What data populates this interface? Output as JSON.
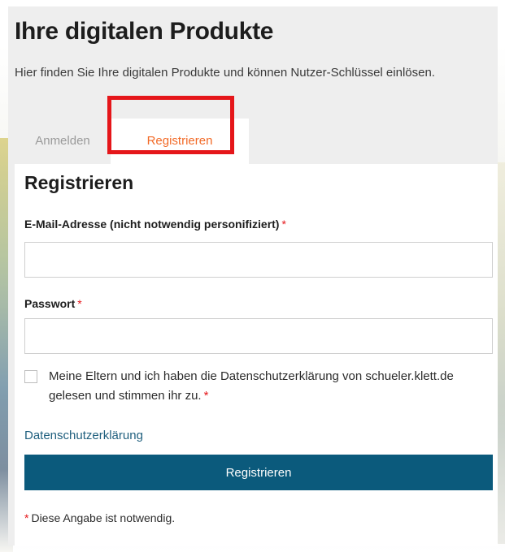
{
  "header": {
    "title": "Ihre digitalen Produkte",
    "intro": "Hier finden Sie Ihre digitalen Produkte und können Nutzer-Schlüssel einlösen."
  },
  "tabs": [
    {
      "label": "Anmelden",
      "active": false
    },
    {
      "label": "Registrieren",
      "active": true
    }
  ],
  "form": {
    "title": "Registrieren",
    "email_label": "E-Mail-Adresse (nicht notwendig personifiziert)",
    "email_value": "",
    "password_label": "Passwort",
    "password_value": "",
    "required_mark": "*",
    "consent_text": "Meine Eltern und ich haben die Datenschutzerklärung von schueler.klett.de gelesen und stimmen ihr zu.",
    "consent_checked": false,
    "privacy_link": "Datenschutzerklärung",
    "submit_label": "Registrieren",
    "required_note": "Diese Angabe ist notwendig."
  },
  "colors": {
    "active_tab": "#f26a27",
    "primary_button": "#0b5a7c",
    "link": "#1f5f7e",
    "required": "#e5161a",
    "highlight": "#e5161a"
  }
}
